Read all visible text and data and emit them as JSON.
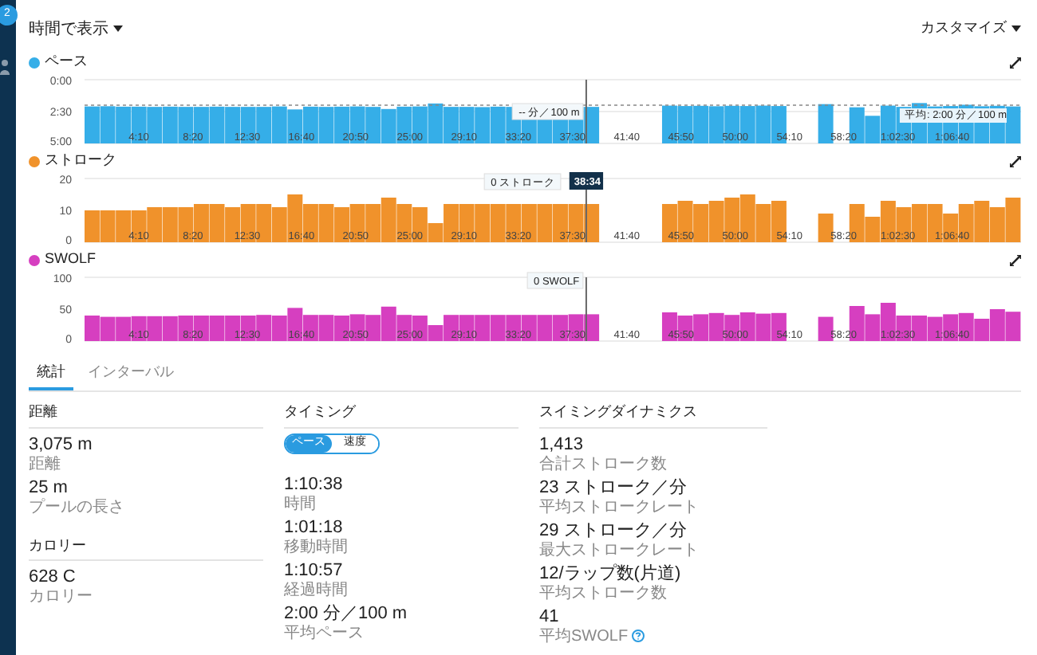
{
  "sidebar": {
    "badge": "2"
  },
  "header": {
    "view_selector": "時間で表示",
    "customize": "カスタマイズ"
  },
  "charts": [
    {
      "legend": "ペース",
      "color": "#35aee8",
      "y_axis_labels": [
        "0:00",
        "2:30",
        "5:00"
      ],
      "x_axis_labels": [
        "4:10",
        "8:20",
        "12:30",
        "16:40",
        "20:50",
        "25:00",
        "29:10",
        "33:20",
        "37:30",
        "41:40",
        "45:50",
        "50:00",
        "54:10",
        "58:20",
        "1:02:30",
        "1:06:40"
      ],
      "average_label": "平均: 2:00 分／100 m",
      "cursor_tooltip": "-- 分／100 m"
    },
    {
      "x_axis_labels": [
        "4:10",
        "8:20",
        "12:30",
        "16:40",
        "20:50",
        "25:00",
        "29:10",
        "33:20",
        "37:30",
        "41:40",
        "45:50",
        "50:00",
        "54:10",
        "58:20",
        "1:02:30",
        "1:06:40"
      ],
      "time_badge": "38:34",
      "cursor_tooltip": "0 ストローク",
      "chart_data": {
        "type": "bar",
        "series": [
          {
            "name": "ストローク",
            "color": "#f0922b",
            "values": [
              10,
              10,
              10,
              10,
              11,
              11,
              11,
              12,
              12,
              11,
              12,
              12,
              11,
              15,
              12,
              12,
              11,
              12,
              12,
              14,
              12,
              11,
              6,
              12,
              12,
              12,
              12,
              12,
              12,
              12,
              12,
              12,
              12,
              null,
              null,
              null,
              null,
              12,
              13,
              12,
              13,
              14,
              15,
              12,
              13,
              null,
              null,
              9,
              null,
              12,
              8,
              13,
              11,
              12,
              12,
              9,
              12,
              13,
              11,
              14
            ]
          }
        ],
        "ylim": [
          0,
          20
        ],
        "yticks": [
          0,
          10,
          20
        ]
      }
    },
    {
      "x_axis_labels": [
        "4:10",
        "8:20",
        "12:30",
        "16:40",
        "20:50",
        "25:00",
        "29:10",
        "33:20",
        "37:30",
        "41:40",
        "45:50",
        "50:00",
        "54:10",
        "58:20",
        "1:02:30",
        "1:06:40"
      ],
      "cursor_tooltip": "0 SWOLF",
      "chart_data": {
        "type": "bar",
        "series": [
          {
            "name": "SWOLF",
            "color": "#d63fc0",
            "values": [
              40,
              38,
              38,
              39,
              39,
              39,
              40,
              40,
              40,
              40,
              40,
              41,
              40,
              52,
              41,
              41,
              40,
              42,
              41,
              54,
              41,
              40,
              25,
              41,
              41,
              41,
              41,
              41,
              41,
              41,
              41,
              42,
              42,
              null,
              null,
              null,
              null,
              45,
              40,
              42,
              44,
              41,
              45,
              43,
              44,
              null,
              null,
              38,
              null,
              55,
              42,
              60,
              40,
              40,
              38,
              42,
              44,
              35,
              50,
              46
            ]
          }
        ],
        "ylim": [
          0,
          100
        ],
        "yticks": [
          0,
          50,
          100
        ]
      }
    }
  ],
  "tabs": [
    {
      "label": "統計",
      "selected": true
    },
    {
      "label": "インターバル",
      "selected": false
    }
  ],
  "stat_columns": [
    {
      "sections": [
        {
          "title": "距離",
          "items": [
            {
              "value": "3,075 m",
              "label": "距離",
              "info": false
            },
            {
              "value": "25 m",
              "label": "プールの長さ",
              "info": false
            }
          ]
        },
        {
          "title": "カロリー",
          "items": [
            {
              "value": "628 C",
              "label": "カロリー",
              "info": false
            }
          ]
        }
      ]
    },
    {
      "sections": [
        {
          "title": "タイミング",
          "toggle": [
            {
              "label": "ペース",
              "selected": true
            },
            {
              "label": "速度",
              "selected": false
            }
          ],
          "items": [
            {
              "value": "1:10:38",
              "label": "時間",
              "info": false
            },
            {
              "value": "1:01:18",
              "label": "移動時間",
              "info": false
            },
            {
              "value": "1:10:57",
              "label": "経過時間",
              "info": false
            },
            {
              "value": "2:00 分／100 m",
              "label": "平均ペース",
              "info": false
            }
          ]
        }
      ]
    },
    {
      "sections": [
        {
          "title": "スイミングダイナミクス",
          "items": [
            {
              "value": "1,413",
              "label": "合計ストローク数",
              "info": false
            },
            {
              "value": "23 ストローク／分",
              "label": "平均ストロークレート",
              "info": false
            },
            {
              "value": "29 ストローク／分",
              "label": "最大ストロークレート",
              "info": false
            },
            {
              "value": "12/ラップ数(片道)",
              "label": "平均ストローク数",
              "info": false
            },
            {
              "value": "41",
              "label": "平均SWOLF",
              "info": true
            }
          ]
        }
      ]
    }
  ]
}
